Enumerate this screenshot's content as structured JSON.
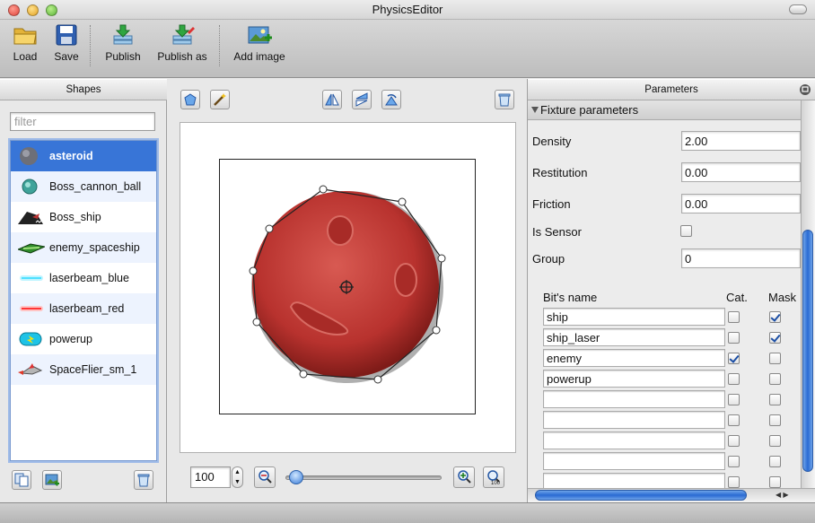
{
  "window": {
    "title": "PhysicsEditor"
  },
  "toolbar": {
    "load": "Load",
    "save": "Save",
    "publish": "Publish",
    "publish_as": "Publish as",
    "add_image": "Add image"
  },
  "shapes_panel": {
    "title": "Shapes",
    "filter_placeholder": "filter",
    "items": [
      {
        "label": "asteroid",
        "icon": "asteroid-icon"
      },
      {
        "label": "Boss_cannon_ball",
        "icon": "cannon-ball-icon"
      },
      {
        "label": "Boss_ship",
        "icon": "boss-ship-icon"
      },
      {
        "label": "enemy_spaceship",
        "icon": "enemy-spaceship-icon"
      },
      {
        "label": "laserbeam_blue",
        "icon": "laser-blue-icon"
      },
      {
        "label": "laserbeam_red",
        "icon": "laser-red-icon"
      },
      {
        "label": "powerup",
        "icon": "powerup-icon"
      },
      {
        "label": "SpaceFlier_sm_1",
        "icon": "spaceflier-icon"
      }
    ],
    "selected": "asteroid"
  },
  "editor": {
    "zoom_value": "100"
  },
  "parameters": {
    "title": "Parameters",
    "section": "Fixture parameters",
    "density_label": "Density",
    "density": "2.00",
    "restitution_label": "Restitution",
    "restitution": "0.00",
    "friction_label": "Friction",
    "friction": "0.00",
    "is_sensor_label": "Is Sensor",
    "is_sensor": false,
    "group_label": "Group",
    "group": "0",
    "bits_header": {
      "name": "Bit's name",
      "cat": "Cat.",
      "mask": "Mask"
    },
    "bits": [
      {
        "name": "ship",
        "cat": false,
        "mask": true
      },
      {
        "name": "ship_laser",
        "cat": false,
        "mask": true
      },
      {
        "name": "enemy",
        "cat": true,
        "mask": false
      },
      {
        "name": "powerup",
        "cat": false,
        "mask": false
      },
      {
        "name": "",
        "cat": false,
        "mask": false
      },
      {
        "name": "",
        "cat": false,
        "mask": false
      },
      {
        "name": "",
        "cat": false,
        "mask": false
      },
      {
        "name": "",
        "cat": false,
        "mask": false
      },
      {
        "name": "",
        "cat": false,
        "mask": false
      }
    ]
  },
  "colors": {
    "selection": "#3875d7",
    "asteroid": "#c03a35"
  }
}
